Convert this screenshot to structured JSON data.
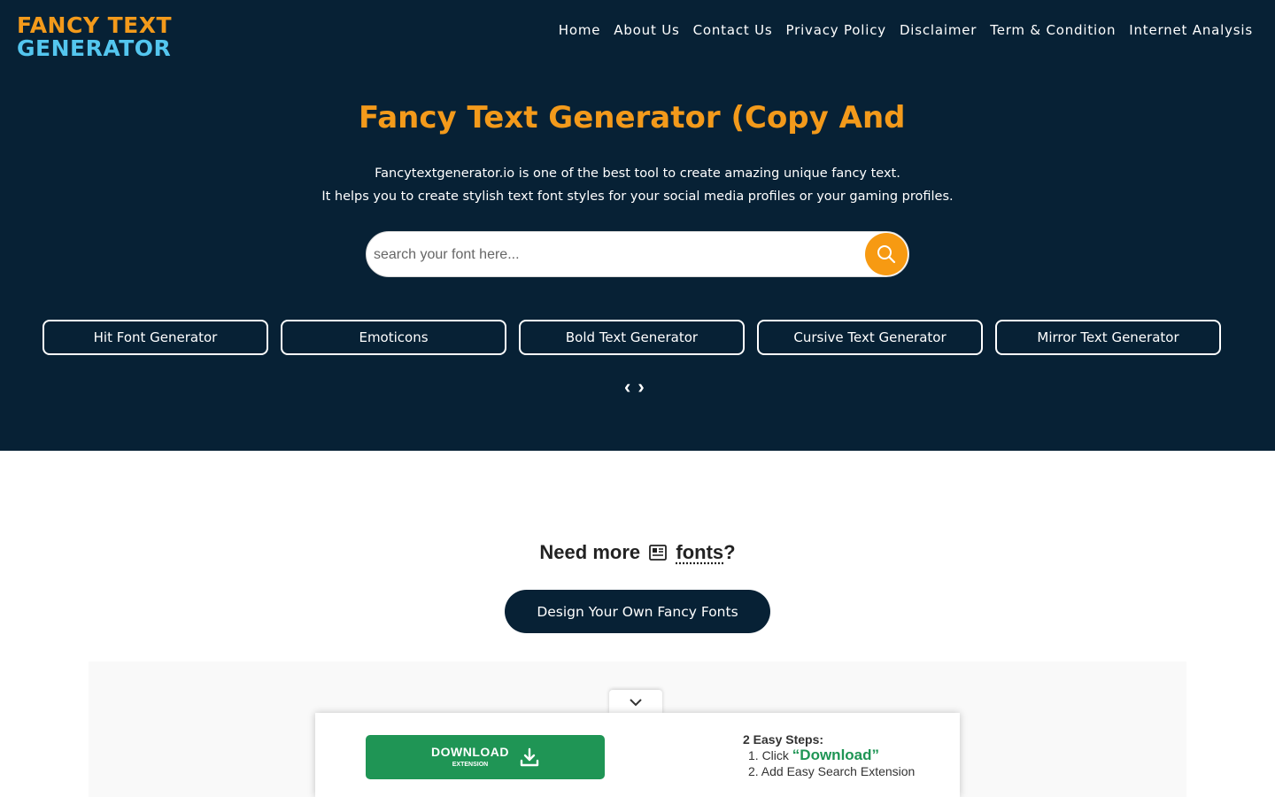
{
  "logo": {
    "line1": "FANCY TEXT",
    "line2": "GENERATOR"
  },
  "nav": [
    "Home",
    "About Us",
    "Contact Us",
    "Privacy Policy",
    "Disclaimer",
    "Term & Condition",
    "Internet Analysis"
  ],
  "hero": {
    "title": "Fancy Text Generator (Copy And Paste)",
    "desc1": "Fancytextgenerator.io is one of the best tool to create amazing unique fancy text.",
    "desc2": "It helps you to create stylish text font styles for your social media profiles or your gaming profiles.",
    "search_placeholder": "search your font here...",
    "chips": [
      "Hit Font Generator",
      "Emoticons",
      "Bold Text Generator",
      "Cursive Text Generator",
      "Mirror Text Generator"
    ],
    "prev_arrow": "‹",
    "next_arrow": "›"
  },
  "need": {
    "prefix": "Need more",
    "link": "fonts",
    "suffix": "?"
  },
  "design_button": "Design Your Own Fancy Fonts",
  "extension": {
    "download_label": "DOWNLOAD",
    "download_sub": "EXTENSION",
    "steps_title": "2 Easy Steps:",
    "step1_prefix": "1. Click ",
    "step1_highlight": "“Download”",
    "step2": "2. Add Easy Search Extension"
  },
  "colors": {
    "navy": "#072135",
    "orange": "#f39a1b",
    "blue": "#54c6ef",
    "green": "#1f9555"
  }
}
